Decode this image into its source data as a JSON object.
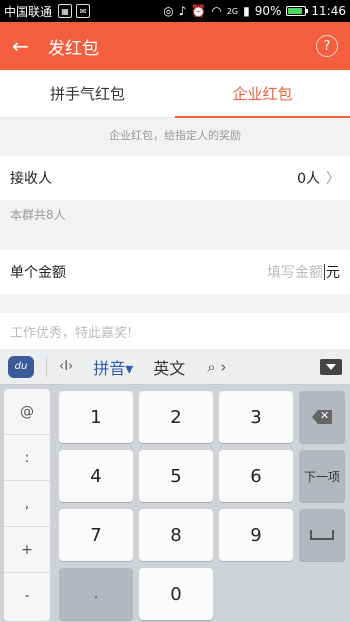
{
  "status_bar": {
    "carrier": "中国联通",
    "battery": "90%",
    "time": "11:46",
    "network": "2G"
  },
  "app_bar": {
    "title": "发红包",
    "help": "?"
  },
  "tabs": [
    {
      "label": "拼手气红包",
      "active": false
    },
    {
      "label": "企业红包",
      "active": true
    }
  ],
  "hint": "企业红包，给指定人的奖励",
  "recipient": {
    "label": "接收人",
    "value": "0人"
  },
  "group_info": "本群共8人",
  "amount": {
    "label": "单个金额",
    "placeholder": "填写金额",
    "unit": "元"
  },
  "message": {
    "placeholder": "工作优秀，特此嘉奖!"
  },
  "keyboard": {
    "logo": "du",
    "mode_label": "拼音▾",
    "english_label": "英文",
    "symbols": [
      "@",
      ":",
      ",",
      "+",
      "-"
    ],
    "keys": [
      "1",
      "2",
      "3",
      "4",
      "5",
      "6",
      "7",
      "8",
      "9",
      ".",
      "0"
    ],
    "next_label": "下一项"
  }
}
